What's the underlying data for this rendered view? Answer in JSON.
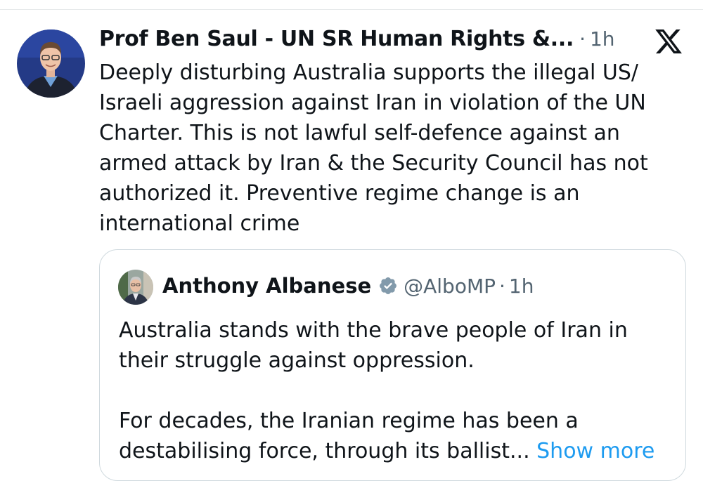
{
  "tweet": {
    "author_name": "Prof Ben Saul - UN SR Human Rights &...",
    "separator": "·",
    "time": "1h",
    "text": "Deeply disturbing Australia supports the illegal US/\nIsraeli aggression against Iran in violation of the UN\nCharter. This is not lawful self-defence against an\narmed attack by Iran & the Security Council has not\nauthorized it. Preventive regime change is an\ninternational crime",
    "platform_icon": "x-logo-icon"
  },
  "quote": {
    "author_name": "Anthony Albanese",
    "verified_icon": "verified-badge-icon",
    "handle": "@AlboMP",
    "separator": "·",
    "time": "1h",
    "paragraph1": "Australia stands with the brave people of Iran in\ntheir struggle against oppression.",
    "paragraph2": "For decades, the Iranian regime has been a\ndestabilising force, through its ballist... ",
    "show_more": "Show more"
  },
  "colors": {
    "text": "#0f1419",
    "secondary": "#536471",
    "link": "#1d9bf0",
    "border": "#cfd9de",
    "badge": "#829aab"
  }
}
